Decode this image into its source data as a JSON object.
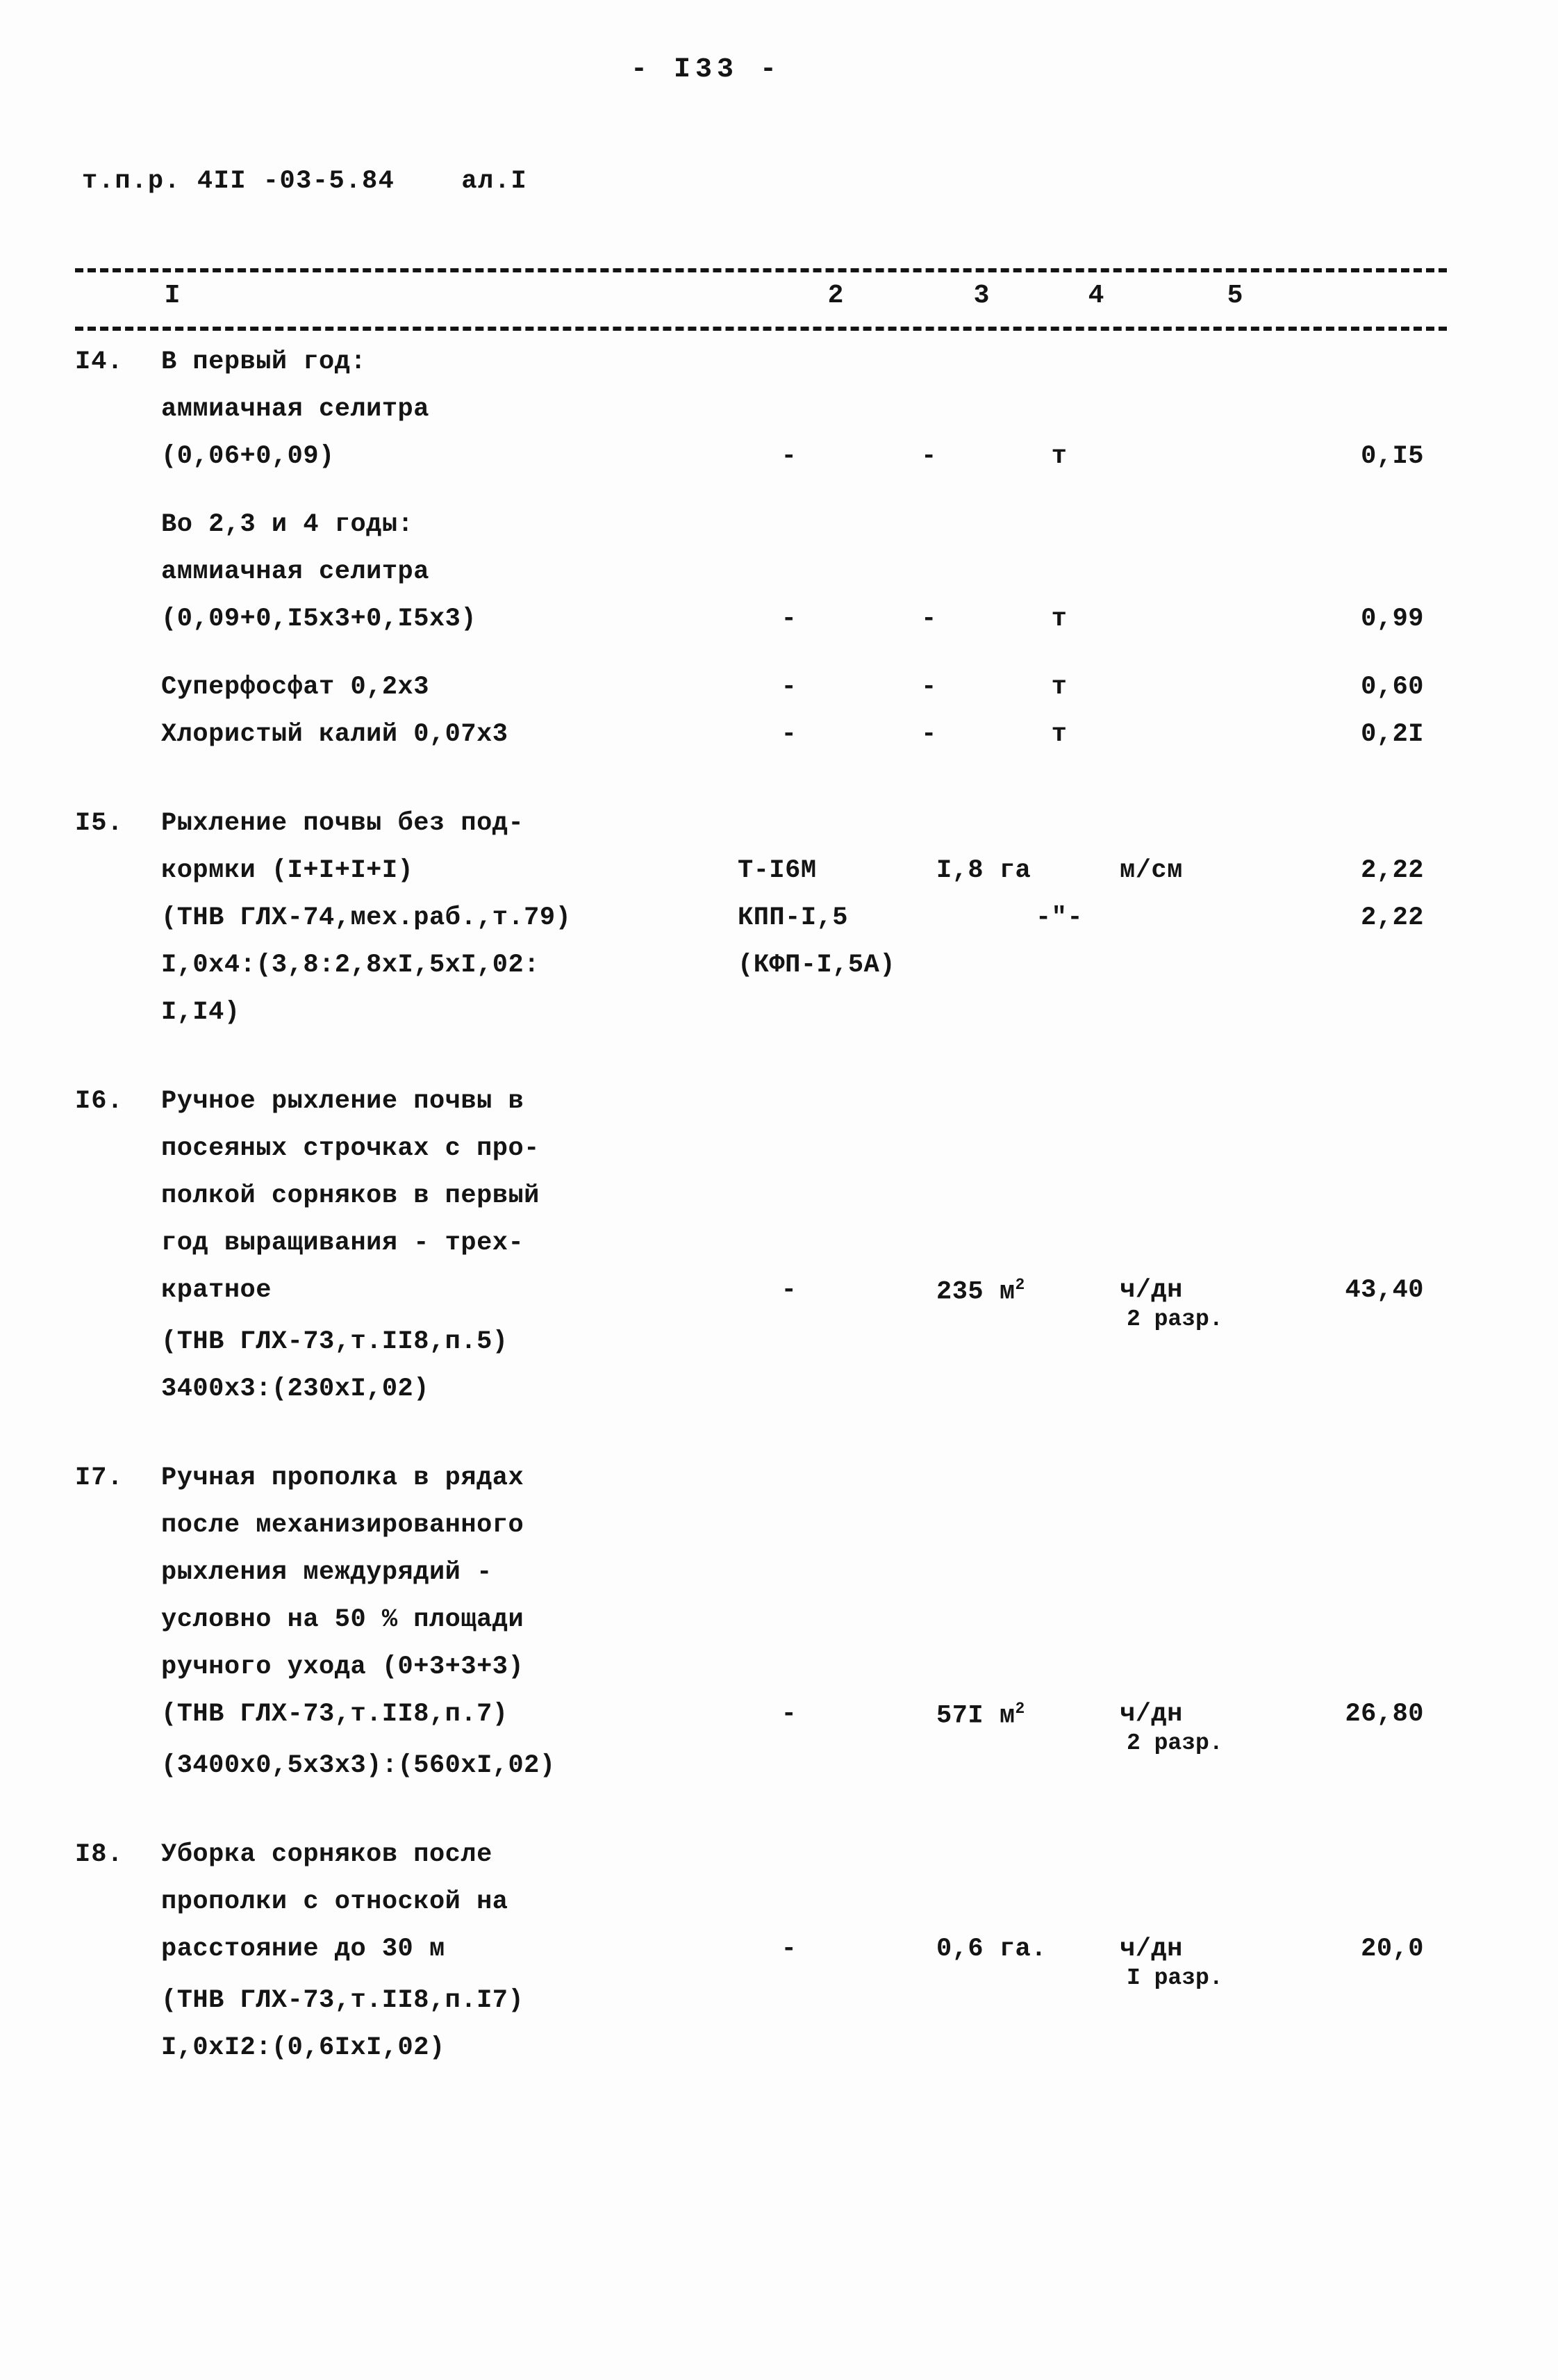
{
  "document": {
    "page_number": "- I33 -",
    "header_code": "т.п.р. 4II -03-5.84",
    "header_annex": "ал.I",
    "column_headers": [
      "I",
      "2",
      "3",
      "4",
      "5"
    ]
  },
  "items": [
    {
      "number": "I4.",
      "lines": [
        {
          "desc": "В первый год:"
        },
        {
          "desc": "аммиачная селитра"
        },
        {
          "desc": "(0,06+0,09)",
          "c2": "-",
          "c3": "-",
          "c4": "т",
          "c5": "0,I5"
        },
        {
          "desc": "Во 2,3 и 4 годы:"
        },
        {
          "desc": "аммиачная селитра"
        },
        {
          "desc": "(0,09+0,I5x3+0,I5x3)",
          "c2": "-",
          "c3": "-",
          "c4": "т",
          "c5": "0,99"
        },
        {
          "desc": "Суперфосфат 0,2x3",
          "c2": "-",
          "c3": "-",
          "c4": "т",
          "c5": "0,60"
        },
        {
          "desc": "Хлористый калий 0,07x3",
          "c2": "-",
          "c3": "-",
          "c4": "т",
          "c5": "0,2I"
        }
      ]
    },
    {
      "number": "I5.",
      "lines": [
        {
          "desc": "Рыхление почвы без под-"
        },
        {
          "desc": "кормки (I+I+I+I)",
          "c2": "Т-I6М",
          "c3": "I,8 га",
          "c4": "м/см",
          "c5": "2,22"
        },
        {
          "desc": "(ТНВ ГЛХ-74,мех.раб.,т.79)",
          "c2": "КПП-I,5",
          "c4": "-\"-",
          "c5": "2,22"
        },
        {
          "desc": "I,0x4:(3,8:2,8xI,5xI,02:",
          "c2": "(КФП-I,5А)"
        },
        {
          "desc": "I,I4)"
        }
      ]
    },
    {
      "number": "I6.",
      "lines": [
        {
          "desc": "Ручное рыхление почвы в"
        },
        {
          "desc": "посеяных строчках с про-"
        },
        {
          "desc": "полкой сорняков в первый"
        },
        {
          "desc": "год выращивания - трех-"
        },
        {
          "desc": "кратное",
          "c2": "-",
          "c3": "235 м",
          "c3_sup": "2",
          "c4": "ч/дн",
          "c4_sub": "2 разр.",
          "c5": "43,40"
        },
        {
          "desc": "(ТНВ ГЛХ-73,т.II8,п.5)"
        },
        {
          "desc": "3400x3:(230xI,02)"
        }
      ]
    },
    {
      "number": "I7.",
      "lines": [
        {
          "desc": "Ручная прополка в рядах"
        },
        {
          "desc": "после механизированного"
        },
        {
          "desc": "рыхления междурядий -"
        },
        {
          "desc": "условно на 50 % площади"
        },
        {
          "desc": "ручного ухода (0+3+3+3)"
        },
        {
          "desc": "(ТНВ ГЛХ-73,т.II8,п.7)",
          "c2": "-",
          "c3": "57I м",
          "c3_sup": "2",
          "c4": "ч/дн",
          "c4_sub": "2 разр.",
          "c5": "26,80"
        },
        {
          "desc": "(3400x0,5x3x3):(560xI,02)"
        }
      ]
    },
    {
      "number": "I8.",
      "lines": [
        {
          "desc": "Уборка сорняков после"
        },
        {
          "desc": "прополки с отноской на"
        },
        {
          "desc": "расстояние до 30 м",
          "c2": "-",
          "c3": "0,6 га.",
          "c4": "ч/дн",
          "c4_sub": "I разр.",
          "c5": "20,0"
        },
        {
          "desc": "(ТНВ ГЛХ-73,т.II8,п.I7)"
        },
        {
          "desc": "I,0xI2:(0,6IxI,02)"
        }
      ]
    }
  ]
}
